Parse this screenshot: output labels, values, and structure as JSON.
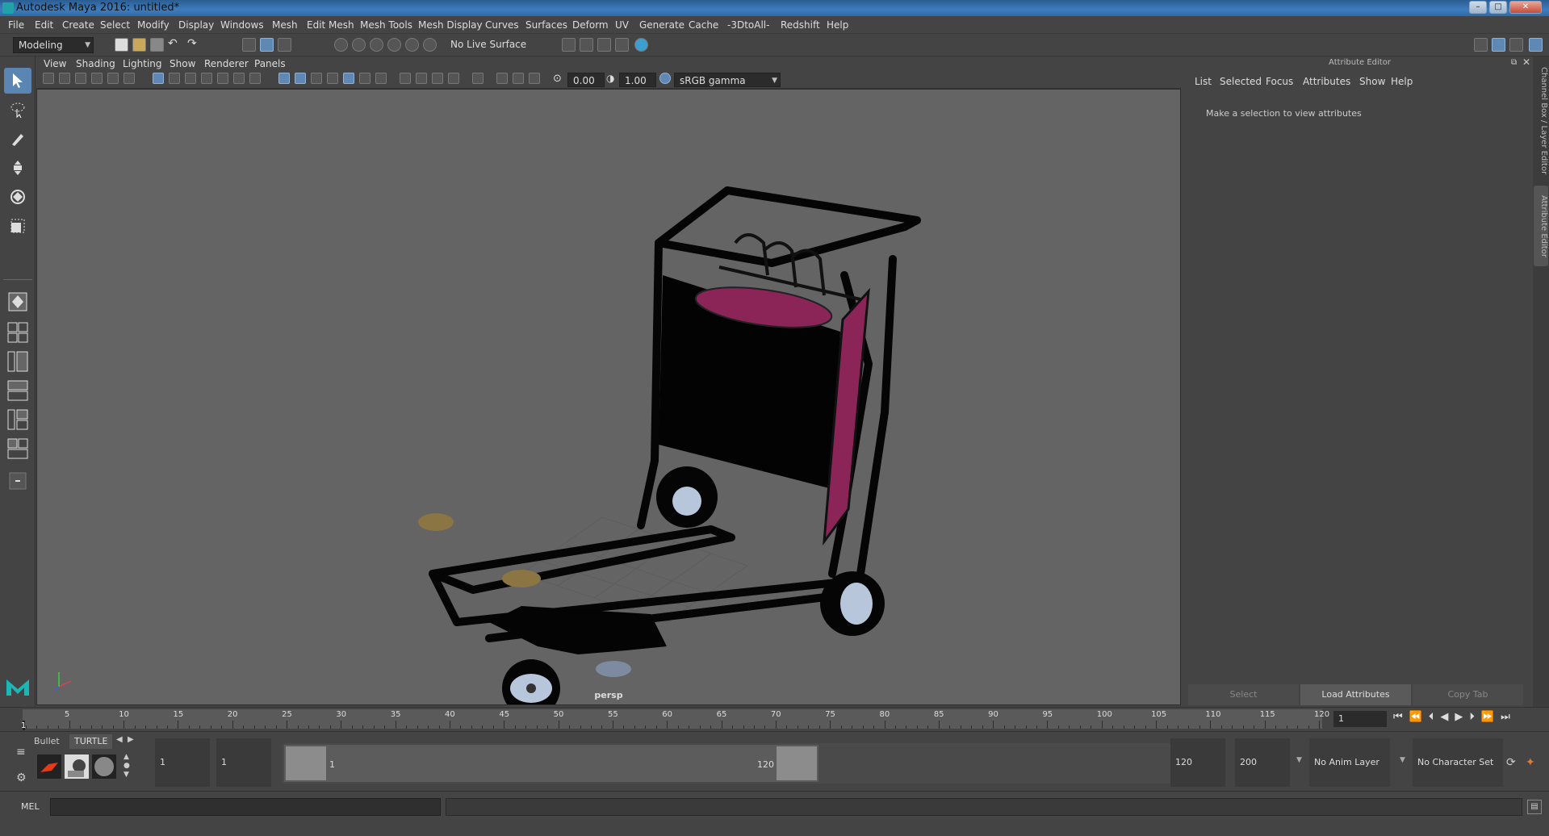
{
  "window": {
    "title": "Autodesk Maya 2016: untitled*"
  },
  "menubar": {
    "items": [
      "File",
      "Edit",
      "Create",
      "Select",
      "Modify",
      "Display",
      "Windows",
      "Mesh",
      "Edit Mesh",
      "Mesh Tools",
      "Mesh Display",
      "Curves",
      "Surfaces",
      "Deform",
      "UV",
      "Generate",
      "Cache",
      "-3DtoAll-",
      "Redshift",
      "Help"
    ]
  },
  "statusline": {
    "mode": "Modeling",
    "live_surface": "No Live Surface"
  },
  "panel": {
    "menu": [
      "View",
      "Shading",
      "Lighting",
      "Show",
      "Renderer",
      "Panels"
    ],
    "exposure": "0.00",
    "gamma": "1.00",
    "color_space": "sRGB gamma",
    "camera_label": "persp"
  },
  "attribute_editor": {
    "header": "Attribute Editor",
    "menu": [
      "List",
      "Selected",
      "Focus",
      "Attributes",
      "Show",
      "Help"
    ],
    "message": "Make a selection to view attributes",
    "buttons": {
      "select": "Select",
      "load": "Load Attributes",
      "copy": "Copy Tab"
    }
  },
  "side_tabs": {
    "channel_box": "Channel Box / Layer Editor",
    "attr_editor": "Attribute Editor"
  },
  "timeline": {
    "ticks": [
      "5",
      "10",
      "15",
      "20",
      "25",
      "30",
      "35",
      "40",
      "45",
      "50",
      "55",
      "60",
      "65",
      "70",
      "75",
      "80",
      "85",
      "90",
      "95",
      "100",
      "105",
      "110",
      "115",
      "120"
    ],
    "start_label": "1",
    "current_frame": "1"
  },
  "range": {
    "shelf_tabs": [
      "Bullet",
      "TURTLE"
    ],
    "start_time": "1",
    "playback_start": "1",
    "range_start_label": "1",
    "range_end_label": "120",
    "playback_end": "120",
    "end_time": "200",
    "anim_layer": "No Anim Layer",
    "character_set": "No Character Set"
  },
  "command": {
    "language": "MEL"
  },
  "colors": {
    "accent": "#5b85b3",
    "viewport_bg": "#646464",
    "panel_bg": "#444444",
    "cart_panel": "#8b2457"
  }
}
